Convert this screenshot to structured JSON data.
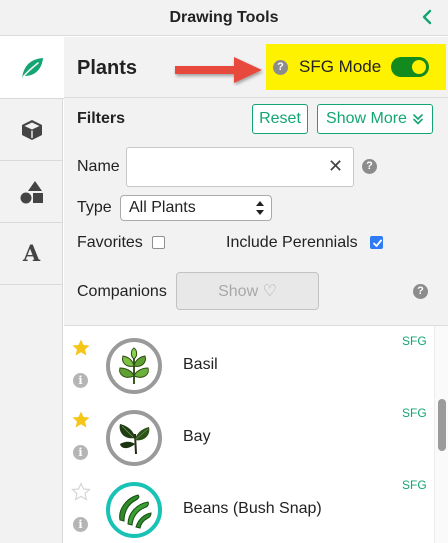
{
  "header": {
    "title": "Drawing Tools",
    "collapse_icon": "chevron-left-icon"
  },
  "sidebar": {
    "tabs": [
      {
        "name": "plants",
        "icon": "leaf-icon",
        "active": true
      },
      {
        "name": "structures",
        "icon": "cube-icon",
        "active": false
      },
      {
        "name": "shapes",
        "icon": "shapes-icon",
        "active": false
      },
      {
        "name": "text",
        "icon": "text-icon",
        "glyph": "A",
        "active": false
      }
    ]
  },
  "panel": {
    "title": "Plants",
    "sfg_mode": {
      "label": "SFG Mode",
      "enabled": true,
      "help_glyph": "?"
    }
  },
  "filters": {
    "title": "Filters",
    "reset_label": "Reset",
    "show_more_label": "Show More",
    "name_label": "Name",
    "name_value": "",
    "name_placeholder": "",
    "clear_glyph": "✕",
    "help_glyph": "?",
    "type_label": "Type",
    "type_value": "All Plants",
    "favorites_label": "Favorites",
    "favorites_checked": false,
    "perennials_label": "Include Perennials",
    "perennials_checked": true,
    "companions_label": "Companions",
    "companions_button_label": "Show ♡"
  },
  "plants": [
    {
      "name": "Basil",
      "favorite": true,
      "badge": "SFG",
      "info_glyph": "i",
      "selected": false
    },
    {
      "name": "Bay",
      "favorite": true,
      "badge": "SFG",
      "info_glyph": "i",
      "selected": false
    },
    {
      "name": "Beans (Bush Snap)",
      "favorite": false,
      "badge": "SFG",
      "info_glyph": "i",
      "selected": true
    }
  ],
  "colors": {
    "accent": "#13a574",
    "toggle_on": "#138a1e",
    "highlight": "#fff200",
    "arrow": "#e84a3c",
    "star": "#f5c518",
    "selected_ring": "#18c3b6"
  }
}
